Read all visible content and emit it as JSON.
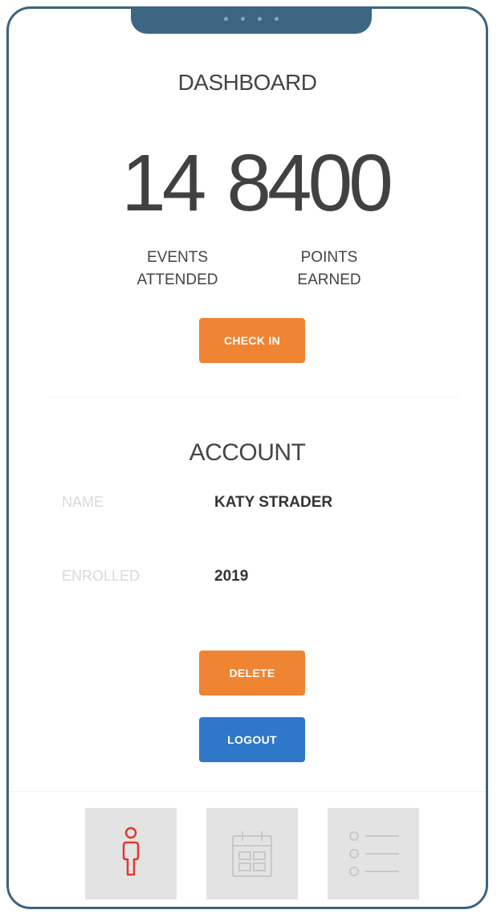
{
  "dashboard": {
    "title": "DASHBOARD",
    "events_value": "14",
    "points_value": "8400",
    "events_label_line1": "EVENTS",
    "events_label_line2": "ATTENDED",
    "points_label_line1": "POINTS",
    "points_label_line2": "EARNED",
    "checkin_label": "CHECK IN"
  },
  "account": {
    "title": "ACCOUNT",
    "name_label": "NAME",
    "name_value": "KATY STRADER",
    "enrolled_label": "ENROLLED",
    "enrolled_value": "2019",
    "delete_label": "DELETE",
    "logout_label": "LOGOUT"
  },
  "tabbar": {
    "tabs": [
      {
        "icon": "person-icon",
        "active": true
      },
      {
        "icon": "calendar-icon",
        "active": false
      },
      {
        "icon": "list-icon",
        "active": false
      }
    ]
  },
  "colors": {
    "accent_orange": "#ef8432",
    "accent_blue": "#2f77c8",
    "frame": "#3a6482",
    "active_icon": "#e0392c",
    "inactive_icon": "#c8c8c8"
  }
}
